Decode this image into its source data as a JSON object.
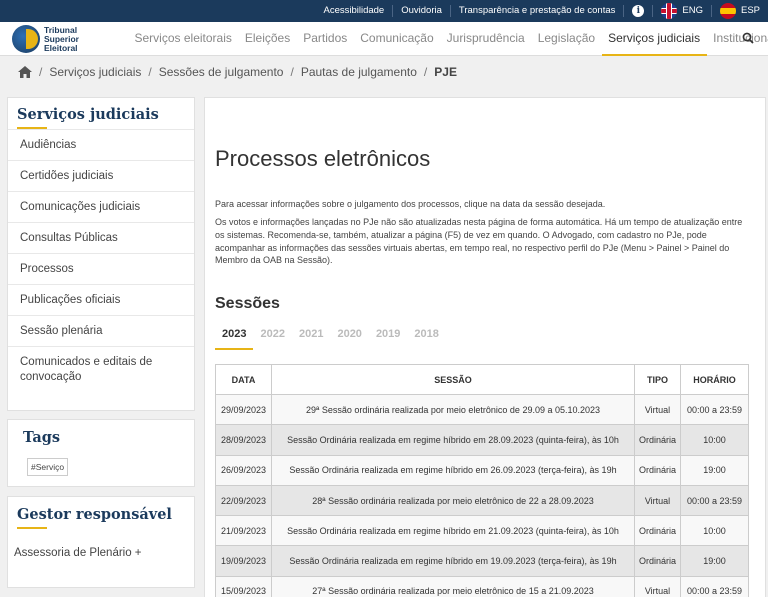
{
  "topbar": {
    "links": [
      "Acessibilidade",
      "Ouvidoria",
      "Transparência e prestação de contas"
    ],
    "info_symbol": "i",
    "lang_en": "ENG",
    "lang_es": "ESP"
  },
  "logo": {
    "line1": "Tribunal",
    "line2": "Superior",
    "line3": "Eleitoral"
  },
  "nav": {
    "items": [
      "Serviços eleitorais",
      "Eleições",
      "Partidos",
      "Comunicação",
      "Jurisprudência",
      "Legislação",
      "Serviços judiciais",
      "Institucional"
    ],
    "active_index": 6
  },
  "breadcrumb": [
    "Serviços judiciais",
    "Sessões de julgamento",
    "Pautas de julgamento",
    "PJE"
  ],
  "sidebar": {
    "title": "Serviços judiciais",
    "items": [
      "Audiências",
      "Certidões judiciais",
      "Comunicações judiciais",
      "Consultas Públicas",
      "Processos",
      "Publicações oficiais",
      "Sessão plenária",
      "Comunicados e editais de convocação"
    ]
  },
  "tags": {
    "title": "Tags",
    "items": [
      "#Serviço"
    ]
  },
  "gestor": {
    "title": "Gestor responsável",
    "link": "Assessoria de Plenário +"
  },
  "main": {
    "title": "Processos eletrônicos",
    "para1": "Para acessar informações sobre o julgamento dos processos, clique na data da sessão desejada.",
    "para2": "Os votos e informações lançadas no PJe não são atualizadas nesta página de forma automática. Há um tempo de atualização entre os sistemas. Recomenda-se, também, atualizar a página (F5) de vez em quando. O Advogado, com cadastro no PJe, pode acompanhar as informações das sessões virtuais abertas, em tempo real, no respectivo perfil do PJe (Menu > Painel > Painel do Membro da OAB na Sessão).",
    "sessions_title": "Sessões",
    "years": [
      "2023",
      "2022",
      "2021",
      "2020",
      "2019",
      "2018"
    ],
    "active_year_index": 0,
    "table": {
      "headers": [
        "DATA",
        "SESSÃO",
        "TIPO",
        "HORÁRIO"
      ],
      "rows": [
        [
          "29/09/2023",
          "29ª Sessão ordinária realizada por meio eletrônico de 29.09 a 05.10.2023",
          "Virtual",
          "00:00 a 23:59"
        ],
        [
          "28/09/2023",
          "Sessão Ordinária realizada em regime híbrido em 28.09.2023 (quinta-feira), às 10h",
          "Ordinária",
          "10:00"
        ],
        [
          "26/09/2023",
          "Sessão Ordinária realizada em regime híbrido em 26.09.2023 (terça-feira), às 19h",
          "Ordinária",
          "19:00"
        ],
        [
          "22/09/2023",
          "28ª Sessão ordinária realizada por meio eletrônico de 22 a 28.09.2023",
          "Virtual",
          "00:00 a 23:59"
        ],
        [
          "21/09/2023",
          "Sessão Ordinária realizada em regime híbrido em 21.09.2023 (quinta-feira), às 10h",
          "Ordinária",
          "10:00"
        ],
        [
          "19/09/2023",
          "Sessão Ordinária realizada em regime híbrido em 19.09.2023 (terça-feira), às 19h",
          "Ordinária",
          "19:00"
        ],
        [
          "15/09/2023",
          "27ª Sessão ordinária realizada por meio eletrônico de 15 a 21.09.2023",
          "Virtual",
          "00:00 a 23:59"
        ]
      ]
    }
  }
}
